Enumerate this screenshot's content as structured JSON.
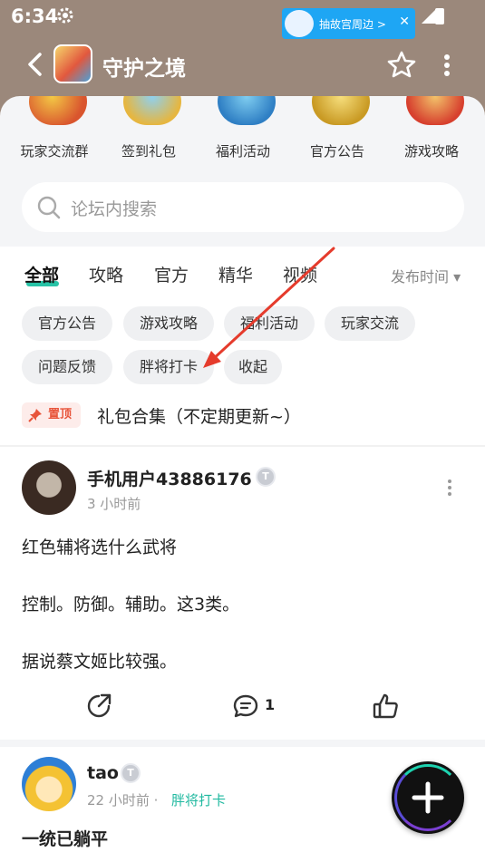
{
  "status_bar": {
    "time": "6:34"
  },
  "banner": {
    "text": "抽故宫周边 >",
    "close": "✕"
  },
  "header": {
    "title": "守护之境"
  },
  "quick_entries": [
    {
      "label": "玩家交流群"
    },
    {
      "label": "签到礼包"
    },
    {
      "label": "福利活动"
    },
    {
      "label": "官方公告"
    },
    {
      "label": "游戏攻略"
    }
  ],
  "search": {
    "placeholder": "论坛内搜索"
  },
  "tabs": [
    {
      "label": "全部"
    },
    {
      "label": "攻略"
    },
    {
      "label": "官方"
    },
    {
      "label": "精华"
    },
    {
      "label": "视频"
    }
  ],
  "sort": {
    "label": "发布时间 ▾"
  },
  "filter_chips": [
    {
      "label": "官方公告"
    },
    {
      "label": "游戏攻略"
    },
    {
      "label": "福利活动"
    },
    {
      "label": "玩家交流"
    },
    {
      "label": "问题反馈"
    },
    {
      "label": "胖将打卡"
    },
    {
      "label": "收起"
    }
  ],
  "pinned": {
    "badge": "置顶",
    "title": "礼包合集（不定期更新~）"
  },
  "posts": [
    {
      "user": "手机用户43886176",
      "level": "T",
      "time": "3 小时前",
      "lines": [
        "红色辅将选什么武将",
        "控制。防御。辅助。这3类。",
        "据说蔡文姬比较强。"
      ],
      "comments": "1"
    },
    {
      "user": "tao",
      "level": "T",
      "time": "22 小时前",
      "separator": "·",
      "category": "胖将打卡",
      "title": "一统已躺平"
    }
  ],
  "colors": {
    "header_bg": "#9b887b",
    "accent": "#27c3a6",
    "annotation": "#e53b2c",
    "banner": "#1ea6f4"
  }
}
